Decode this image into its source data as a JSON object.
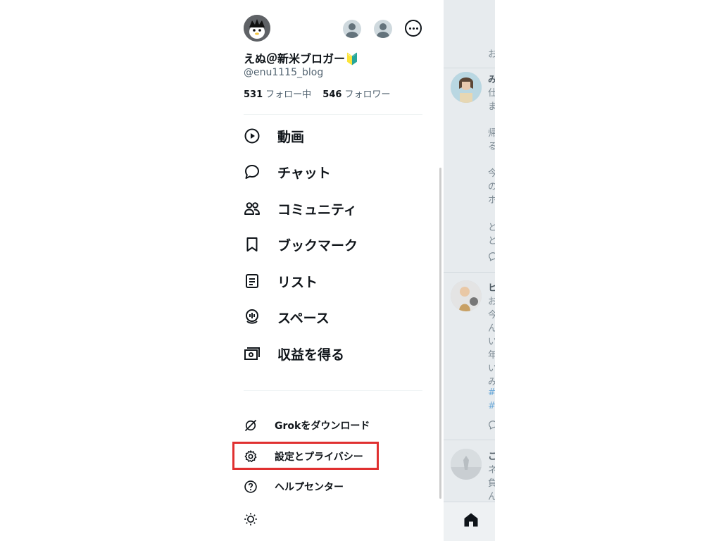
{
  "profile": {
    "display_name": "えぬ＠新米ブロガー🔰",
    "handle": "@enu1115_blog",
    "following_count": "531",
    "following_label": "フォロー中",
    "followers_count": "546",
    "followers_label": "フォロワー"
  },
  "nav": {
    "items": [
      {
        "label": "動画",
        "icon": "play-circle-icon"
      },
      {
        "label": "チャット",
        "icon": "chat-bubble-icon"
      },
      {
        "label": "コミュニティ",
        "icon": "people-icon"
      },
      {
        "label": "ブックマーク",
        "icon": "bookmark-icon"
      },
      {
        "label": "リスト",
        "icon": "list-icon"
      },
      {
        "label": "スペース",
        "icon": "spaces-mic-icon"
      },
      {
        "label": "収益を得る",
        "icon": "money-icon"
      }
    ]
  },
  "secondary": {
    "items": [
      {
        "label": "Grokをダウンロード",
        "icon": "grok-icon"
      },
      {
        "label": "設定とプライバシー",
        "icon": "gear-icon"
      },
      {
        "label": "ヘルプセンター",
        "icon": "help-icon"
      }
    ],
    "theme_icon": "sun-icon"
  },
  "backdrop": {
    "lines": [
      "お",
      "み",
      "仕",
      "ま",
      "帰",
      "る",
      "今",
      "の",
      "ホ",
      "と",
      "と",
      "ヒ",
      "お",
      "今",
      "ん",
      "い",
      "年",
      "い",
      "み",
      "#",
      "#",
      "こ",
      "ネ",
      "負",
      "ん"
    ],
    "home_icon": "home-icon"
  },
  "colors": {
    "highlight": "#e03030",
    "hashtag": "#6aa8d8"
  }
}
